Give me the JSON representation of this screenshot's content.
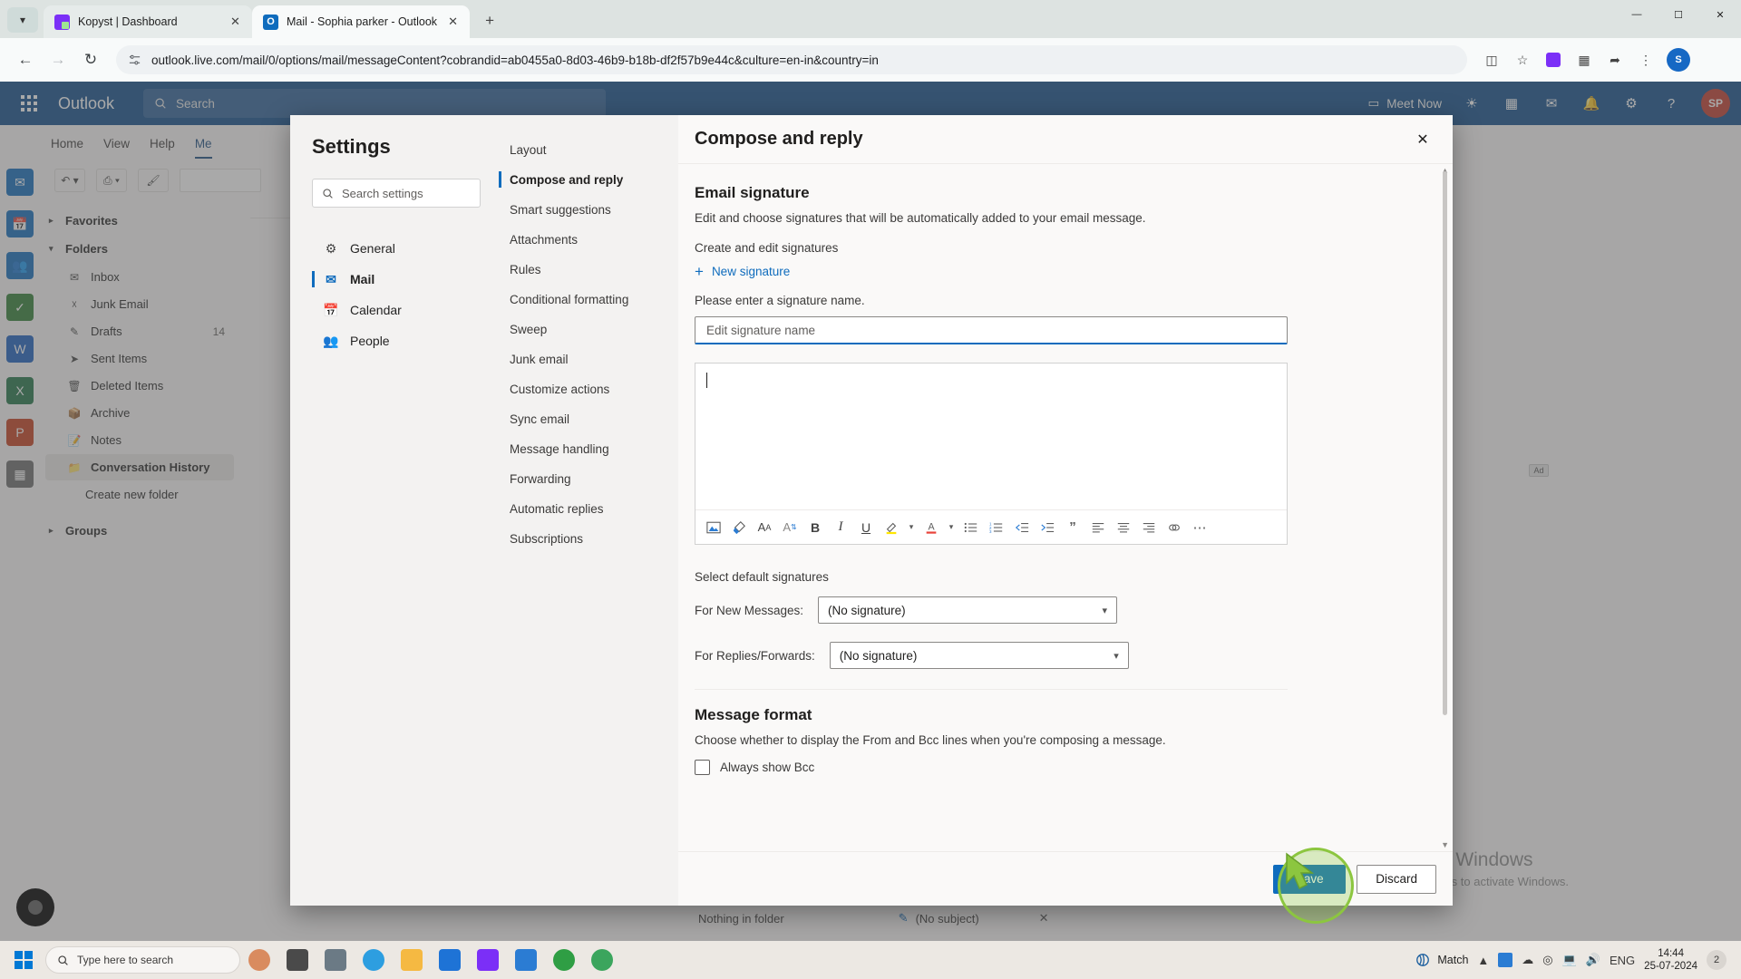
{
  "browser": {
    "tabs": [
      {
        "title": "Kopyst | Dashboard",
        "favicon": "kopyst-icon",
        "active": false
      },
      {
        "title": "Mail - Sophia parker - Outlook",
        "favicon": "outlook-icon",
        "active": true
      }
    ],
    "new_tab_label": "+",
    "window_controls": {
      "minimize": "—",
      "maximize": "☐",
      "close": "✕"
    },
    "url": "outlook.live.com/mail/0/options/mail/messageContent?cobrandid=ab0455a0-8d03-46b9-b18b-df2f57b9e44c&culture=en-in&country=in",
    "nav": {
      "back": "←",
      "forward": "→",
      "reload": "↻"
    },
    "profile_initial": "S"
  },
  "outlook": {
    "brand": "Outlook",
    "search_placeholder": "Search",
    "meet_now": "Meet Now",
    "avatar_initials": "SP",
    "ribbon_tabs": [
      "Home",
      "View",
      "Help",
      "Me"
    ],
    "folders": {
      "favorites_label": "Favorites",
      "folders_label": "Folders",
      "groups_label": "Groups",
      "items": [
        {
          "label": "Inbox",
          "count": ""
        },
        {
          "label": "Junk Email",
          "count": ""
        },
        {
          "label": "Drafts",
          "count": "14"
        },
        {
          "label": "Sent Items",
          "count": ""
        },
        {
          "label": "Deleted Items",
          "count": ""
        },
        {
          "label": "Archive",
          "count": ""
        },
        {
          "label": "Notes",
          "count": ""
        },
        {
          "label": "Conversation History",
          "count": ""
        }
      ],
      "create_new_folder": "Create new folder"
    },
    "status_bar": {
      "nothing_in_folder": "Nothing in folder",
      "subject": "(No subject)"
    },
    "ad_badge": "Ad",
    "watermark": {
      "line1": "Activate Windows",
      "line2": "Go to Settings to activate Windows."
    }
  },
  "settings": {
    "title": "Settings",
    "search_placeholder": "Search settings",
    "categories": [
      {
        "label": "General",
        "icon": "gear-icon",
        "selected": false
      },
      {
        "label": "Mail",
        "icon": "mail-icon",
        "selected": true
      },
      {
        "label": "Calendar",
        "icon": "calendar-icon",
        "selected": false
      },
      {
        "label": "People",
        "icon": "people-icon",
        "selected": false
      }
    ],
    "subcategories": [
      {
        "label": "Layout",
        "selected": false
      },
      {
        "label": "Compose and reply",
        "selected": true
      },
      {
        "label": "Smart suggestions",
        "selected": false
      },
      {
        "label": "Attachments",
        "selected": false
      },
      {
        "label": "Rules",
        "selected": false
      },
      {
        "label": "Conditional formatting",
        "selected": false
      },
      {
        "label": "Sweep",
        "selected": false
      },
      {
        "label": "Junk email",
        "selected": false
      },
      {
        "label": "Customize actions",
        "selected": false
      },
      {
        "label": "Sync email",
        "selected": false
      },
      {
        "label": "Message handling",
        "selected": false
      },
      {
        "label": "Forwarding",
        "selected": false
      },
      {
        "label": "Automatic replies",
        "selected": false
      },
      {
        "label": "Subscriptions",
        "selected": false
      }
    ],
    "panel": {
      "heading": "Compose and reply",
      "close_label": "✕",
      "email_signature": {
        "section_title": "Email signature",
        "description": "Edit and choose signatures that will be automatically added to your email message.",
        "create_label": "Create and edit signatures",
        "new_signature_label": "New signature",
        "validation_message": "Please enter a signature name.",
        "name_placeholder": "Edit signature name",
        "name_value": "",
        "body_value": ""
      },
      "editor_toolbar": [
        "insert-picture-icon",
        "format-painter-icon",
        "font-size-icon",
        "text-effects-icon",
        "bold-icon",
        "italic-icon",
        "underline-icon",
        "highlight-color-icon",
        "highlight-chevron-icon",
        "font-color-icon",
        "font-color-chevron-icon",
        "bulleted-list-icon",
        "numbered-list-icon",
        "decrease-indent-icon",
        "increase-indent-icon",
        "quote-icon",
        "align-left-icon",
        "align-center-icon",
        "align-right-icon",
        "insert-link-icon",
        "more-options-icon"
      ],
      "default_signatures": {
        "section_label": "Select default signatures",
        "new_messages_label": "For New Messages:",
        "new_messages_value": "(No signature)",
        "replies_label": "For Replies/Forwards:",
        "replies_value": "(No signature)",
        "options": [
          "(No signature)"
        ]
      },
      "message_format": {
        "section_title": "Message format",
        "description": "Choose whether to display the From and Bcc lines when you're composing a message.",
        "always_show_bcc_label": "Always show Bcc",
        "always_show_bcc_checked": false
      }
    },
    "footer": {
      "save_label": "Save",
      "discard_label": "Discard"
    },
    "accent_color": "#0f6cbd"
  },
  "taskbar": {
    "search_placeholder": "Type here to search",
    "tray": {
      "match_label": "Match",
      "language": "ENG",
      "time": "14:44",
      "date": "25-07-2024",
      "notification_count": "2"
    }
  }
}
